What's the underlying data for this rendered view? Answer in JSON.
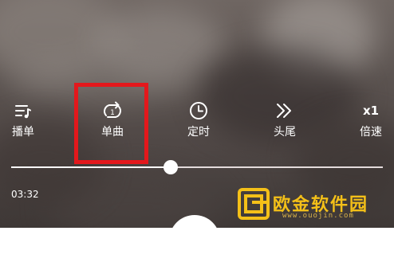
{
  "player": {
    "toolbar": [
      {
        "icon": "playlist-icon",
        "label": "播单"
      },
      {
        "icon": "repeat-one-icon",
        "label": "单曲"
      },
      {
        "icon": "clock-icon",
        "label": "定时"
      },
      {
        "icon": "skip-intro-icon",
        "label": "头尾"
      },
      {
        "icon": "speed-icon",
        "label": "倍速",
        "value": "x1"
      }
    ],
    "repeat_one_badge": "1",
    "progress": {
      "elapsed": "03:32",
      "fraction": 0.43
    }
  },
  "highlight": {
    "target": "repeat-one-button",
    "color": "#e3181c"
  },
  "watermark": {
    "text": "欧金软件园",
    "url": "www.ouojin.com",
    "color": "#f4c018"
  }
}
